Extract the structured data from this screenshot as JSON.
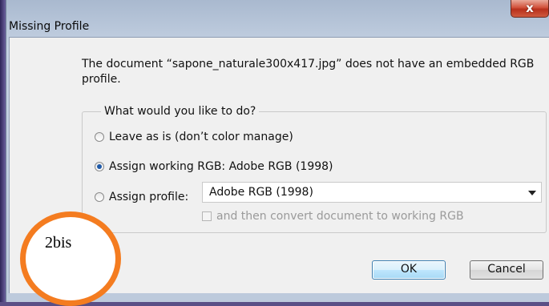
{
  "dialog": {
    "title": "Missing Profile",
    "close_glyph": "x",
    "message": "The document “sapone_naturale300x417.jpg” does not have an embedded RGB profile.",
    "group_legend": "What would you like to do?",
    "options": [
      {
        "label": "Leave as is (don’t color manage)",
        "selected": false
      },
      {
        "label": "Assign working RGB:  Adobe RGB (1998)",
        "selected": true
      },
      {
        "label": "Assign profile:",
        "selected": false
      }
    ],
    "profile_select": {
      "value": "Adobe RGB (1998)"
    },
    "convert_checkbox": {
      "label": "and then convert document to working RGB",
      "checked": false,
      "enabled": false
    },
    "ok_label": "OK",
    "cancel_label": "Cancel"
  },
  "annotation": {
    "text": "2bis",
    "color": "#f47c20"
  },
  "colors": {
    "accent": "#3c7fb1",
    "title_bg": "#c4d1e2",
    "close": "#c9442c"
  }
}
